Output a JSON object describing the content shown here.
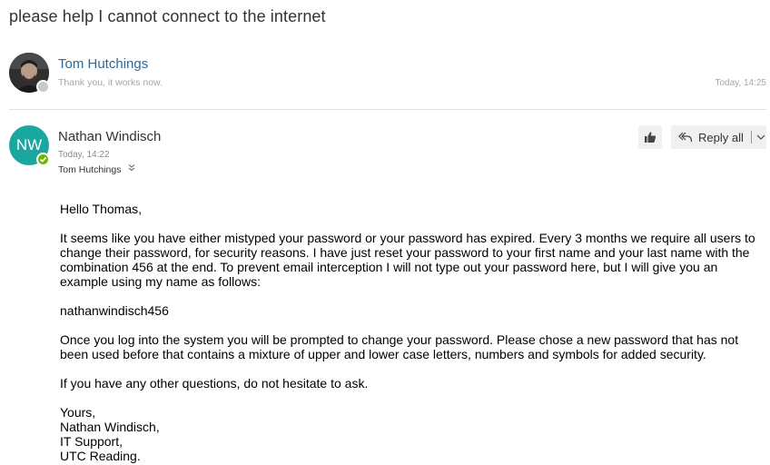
{
  "subject": "please help I cannot connect to the internet",
  "messages": [
    {
      "sender": "Tom Hutchings",
      "preview": "Thank you, it works now.",
      "time": "Today, 14:25"
    },
    {
      "sender": "Nathan Windisch",
      "initials": "NW",
      "time": "Today, 14:22",
      "to": "Tom Hutchings",
      "actions": {
        "reply_all": "Reply all"
      },
      "body": {
        "greeting": "Hello Thomas,",
        "para1": "It seems like you have either mistyped your password or your password has expired. Every 3 months we require all users to change their password, for security reasons. I have just reset your password to your first name and your last name with the combination 456 at the end. To prevent email interception I will not type out your password here, but I will give you an example using my name as follows:",
        "example": "nathanwindisch456",
        "para2": "Once you log into the system you will be prompted to change your password. Please chose a new password that has not been used before that contains a mixture of upper and lower case letters, numbers and symbols for added security.",
        "para3": "If you have any other questions, do not hesitate to ask.",
        "signature": [
          "Yours,",
          "Nathan Windisch,",
          "IT Support,",
          "UTC Reading."
        ]
      }
    }
  ],
  "icons": {
    "like": "thumbs-up-icon",
    "reply_all": "reply-all-icon",
    "expand": "chevron-down-icon",
    "recipients": "double-chevron-down-icon"
  },
  "colors": {
    "link": "#2b6a9a",
    "avatar": "#1aa7a0",
    "presence_online": "#6bb700",
    "presence_offline": "#c8c8c8",
    "button_bg": "#f0f0f0"
  }
}
